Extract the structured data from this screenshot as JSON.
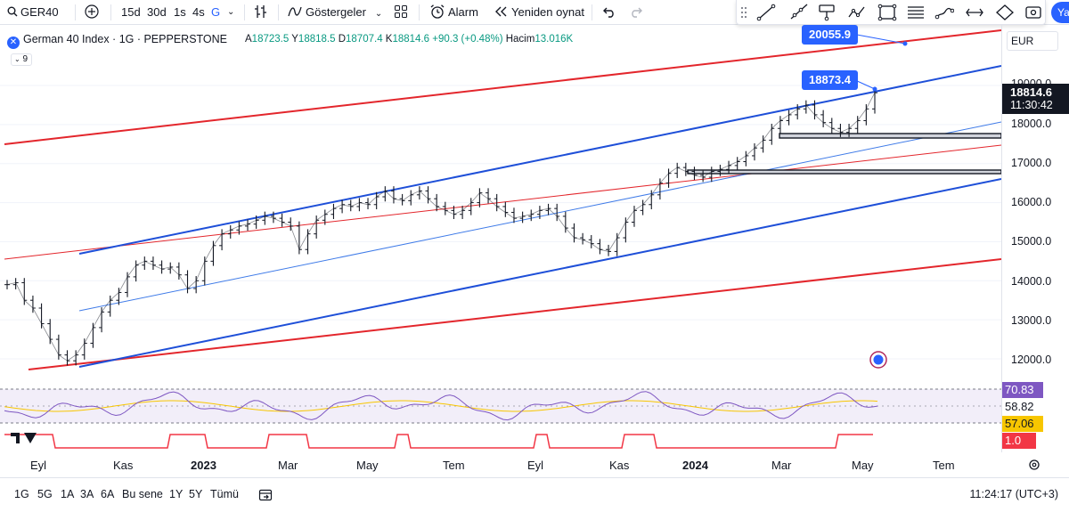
{
  "toolbar": {
    "symbol": "GER40",
    "intervals": [
      "15d",
      "30d",
      "1s",
      "4s",
      "G"
    ],
    "active_interval": "G",
    "indicators_label": "Göstergeler",
    "alarm_label": "Alarm",
    "replay_label": "Yeniden oynat",
    "publish_label": "Yay"
  },
  "legend": {
    "title": "German 40 Index · 1G · PEPPERSTONE",
    "ohlc_prefix": "A",
    "open": "18723.5",
    "high_prefix": "Y",
    "high": "18818.5",
    "low_prefix": "D",
    "low": "18707.4",
    "close_prefix": "K",
    "close": "18814.6",
    "change": "+90.3 (+0.48%)",
    "volume_label": "Hacim",
    "volume": "13.016K",
    "collapse_count": "9"
  },
  "price_axis": {
    "currency": "EUR",
    "labels": [
      "19000.0",
      "18000.0",
      "17000.0",
      "16000.0",
      "15000.0",
      "14000.0",
      "13000.0",
      "12000.0"
    ],
    "last_price": "18814.6",
    "countdown": "11:30:42",
    "rsi_value": "70.83",
    "rsi_ma": "58.82",
    "rsi_aux": "57.06",
    "sub_value": "1.0"
  },
  "callouts": {
    "target_upper": "20055.9",
    "target_near": "18873.4"
  },
  "time_axis": {
    "labels": [
      {
        "text": "Eyl",
        "bold": false
      },
      {
        "text": "Kas",
        "bold": false
      },
      {
        "text": "2023",
        "bold": true
      },
      {
        "text": "Mar",
        "bold": false
      },
      {
        "text": "May",
        "bold": false
      },
      {
        "text": "Tem",
        "bold": false
      },
      {
        "text": "Eyl",
        "bold": false
      },
      {
        "text": "Kas",
        "bold": false
      },
      {
        "text": "2024",
        "bold": true
      },
      {
        "text": "Mar",
        "bold": false
      },
      {
        "text": "May",
        "bold": false
      },
      {
        "text": "Tem",
        "bold": false
      }
    ]
  },
  "bottom_bar": {
    "ranges": [
      "1G",
      "5G",
      "1A",
      "3A",
      "6A",
      "Bu sene",
      "1Y",
      "5Y",
      "Tümü"
    ],
    "clock": "11:24:17 (UTC+3)"
  },
  "colors": {
    "accent": "#2962ff",
    "channel_red": "#e3262c",
    "channel_blue": "#1e4fd8",
    "bull": "#089981",
    "rsi_line": "#7e57c2",
    "rsi_ma": "#f7c600",
    "price_box": "#131722"
  },
  "chart_data": {
    "type": "line",
    "title": "German 40 Index · 1G · PEPPERSTONE",
    "ylim": [
      11700,
      20500
    ],
    "yticks": [
      12000,
      13000,
      14000,
      15000,
      16000,
      17000,
      18000,
      19000
    ],
    "series": [
      {
        "values": [
          13900,
          13950,
          13500,
          13300,
          12900,
          12500,
          12100,
          11950,
          12100,
          12400,
          12800,
          13200,
          13500,
          13700,
          14100,
          14400,
          14500,
          14400,
          14300,
          14350,
          14150,
          13800,
          14000,
          14500,
          14900,
          15200,
          15300,
          15400,
          15450,
          15550,
          15650,
          15600,
          15500,
          15400,
          14800,
          15200,
          15550,
          15700,
          15850,
          15950,
          15900,
          16000,
          15950,
          16150,
          16300,
          16100,
          16050,
          16200,
          16300,
          16100,
          15900,
          15800,
          15700,
          15800,
          16000,
          16250,
          16100,
          15900,
          15750,
          15600,
          15650,
          15700,
          15800,
          15850,
          15650,
          15350,
          15100,
          15050,
          14950,
          14800,
          14750,
          15100,
          15500,
          15800,
          15950,
          16200,
          16500,
          16750,
          16900,
          16800,
          16700,
          16650,
          16800,
          16850,
          16950,
          17050,
          17200,
          17400,
          17600,
          17900,
          18100,
          18250,
          18400,
          18500,
          18250,
          18050,
          17900,
          17800,
          17900,
          18100,
          18400,
          18814.6
        ]
      }
    ]
  }
}
